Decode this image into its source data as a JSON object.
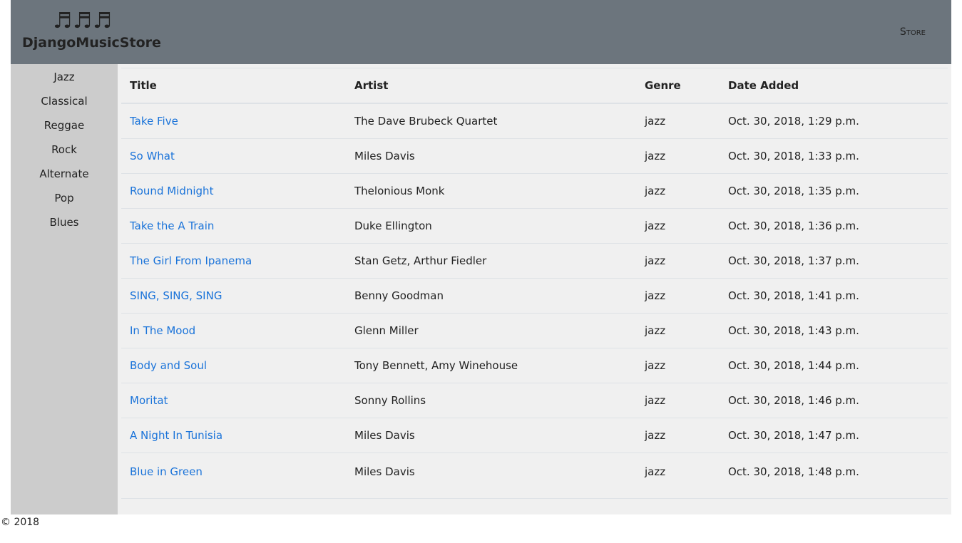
{
  "header": {
    "logo_icons": "♬♬♬",
    "site_name": "DjangoMusicStore",
    "nav_store": "Store"
  },
  "sidebar": {
    "genres": [
      "Jazz",
      "Classical",
      "Reggae",
      "Rock",
      "Alternate",
      "Pop",
      "Blues"
    ]
  },
  "table": {
    "columns": [
      "Title",
      "Artist",
      "Genre",
      "Date Added"
    ],
    "rows": [
      {
        "title": "Take Five",
        "artist": "The Dave Brubeck Quartet",
        "genre": "jazz",
        "date": "Oct. 30, 2018, 1:29 p.m."
      },
      {
        "title": "So What",
        "artist": "Miles Davis",
        "genre": "jazz",
        "date": "Oct. 30, 2018, 1:33 p.m."
      },
      {
        "title": "Round Midnight",
        "artist": "Thelonious Monk",
        "genre": "jazz",
        "date": "Oct. 30, 2018, 1:35 p.m."
      },
      {
        "title": "Take the A Train",
        "artist": "Duke Ellington",
        "genre": "jazz",
        "date": "Oct. 30, 2018, 1:36 p.m."
      },
      {
        "title": "The Girl From Ipanema",
        "artist": "Stan Getz, Arthur Fiedler",
        "genre": "jazz",
        "date": "Oct. 30, 2018, 1:37 p.m."
      },
      {
        "title": "SING, SING, SING",
        "artist": "Benny Goodman",
        "genre": "jazz",
        "date": "Oct. 30, 2018, 1:41 p.m."
      },
      {
        "title": "In The Mood",
        "artist": "Glenn Miller",
        "genre": "jazz",
        "date": "Oct. 30, 2018, 1:43 p.m."
      },
      {
        "title": "Body and Soul",
        "artist": "Tony Bennett, Amy Winehouse",
        "genre": "jazz",
        "date": "Oct. 30, 2018, 1:44 p.m."
      },
      {
        "title": "Moritat",
        "artist": "Sonny Rollins",
        "genre": "jazz",
        "date": "Oct. 30, 2018, 1:46 p.m."
      },
      {
        "title": "A Night In Tunisia",
        "artist": "Miles Davis",
        "genre": "jazz",
        "date": "Oct. 30, 2018, 1:47 p.m."
      },
      {
        "title": "Blue in Green",
        "artist": "Miles Davis",
        "genre": "jazz",
        "date": "Oct. 30, 2018, 1:48 p.m."
      }
    ]
  },
  "footer": {
    "copyright": "© 2018"
  },
  "colors": {
    "header_bg": "#6c757d",
    "sidebar_bg": "#cccccc",
    "content_bg": "#f0f0f0",
    "link": "#1a73d9"
  }
}
